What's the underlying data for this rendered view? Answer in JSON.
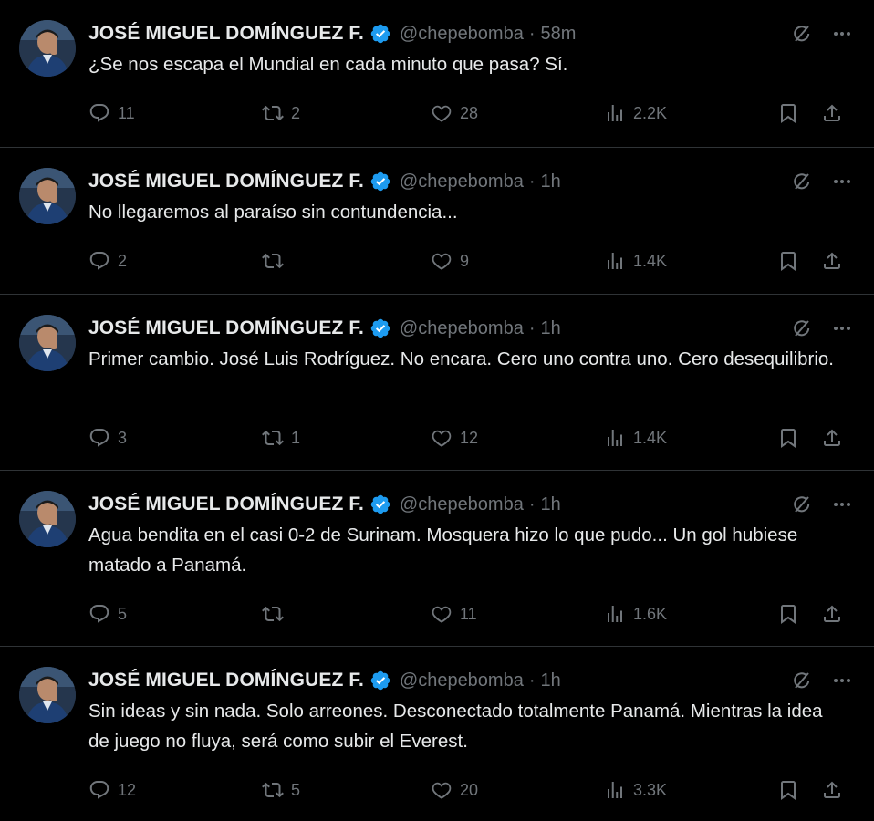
{
  "author": {
    "name": "JOSÉ MIGUEL DOMÍNGUEZ F.",
    "handle": "@chepebomba",
    "verified_color": "#1d9bf0"
  },
  "colors": {
    "background": "#000000",
    "text": "#e7e9ea",
    "muted": "#71767b",
    "divider": "#2f3336",
    "verified": "#1d9bf0"
  },
  "icons": {
    "reply": "reply-icon",
    "retweet": "retweet-icon",
    "like": "heart-icon",
    "views": "views-icon",
    "bookmark": "bookmark-icon",
    "share": "share-icon",
    "grok": "grok-icon",
    "more": "more-icon"
  },
  "tweets": [
    {
      "time": "58m",
      "text": "¿Se nos escapa el Mundial en cada minuto que pasa? Sí.",
      "replies": "11",
      "retweets": "2",
      "likes": "28",
      "views": "2.2K"
    },
    {
      "time": "1h",
      "text": "No llegaremos al paraíso sin contundencia...",
      "replies": "2",
      "retweets": "",
      "likes": "9",
      "views": "1.4K"
    },
    {
      "time": "1h",
      "text": "Primer cambio. José Luis Rodríguez. No encara. Cero uno contra uno. Cero desequilibrio.",
      "replies": "3",
      "retweets": "1",
      "likes": "12",
      "views": "1.4K"
    },
    {
      "time": "1h",
      "text": "Agua bendita en el casi 0-2 de Surinam. Mosquera hizo lo que pudo... Un gol hubiese matado a Panamá.",
      "replies": "5",
      "retweets": "",
      "likes": "11",
      "views": "1.6K"
    },
    {
      "time": "1h",
      "text": "Sin ideas y sin nada. Solo arreones. Desconectado totalmente Panamá. Mientras la idea de juego no fluya, será como subir el Everest.",
      "replies": "12",
      "retweets": "5",
      "likes": "20",
      "views": "3.3K"
    }
  ]
}
